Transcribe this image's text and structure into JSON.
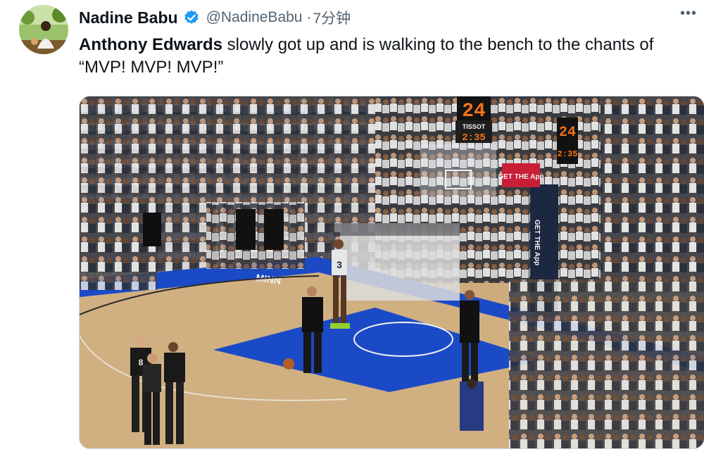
{
  "author": {
    "display_name": "Nadine Babu",
    "handle": "@NadineBabu",
    "separator": "·",
    "time": "7分钟",
    "verified": true
  },
  "tweet": {
    "bold_name": "Anthony Edwards",
    "text_after": " slowly got up and is walking to the bench to the chants of “MVP! MVP! MVP!”"
  },
  "icons": {
    "more": "more-icon",
    "verified": "verified-badge-icon"
  },
  "media": {
    "shot_clock": "24",
    "game_clock": "2:35",
    "sponsor_sign": "TISSOT",
    "ad_board": "GET THE App",
    "side_clock_top": "24",
    "side_clock_bottom": "2:35",
    "jersey_number": "3",
    "ref_jersey": "8",
    "banner_text": "MINN"
  },
  "colors": {
    "name": "#0f1419",
    "secondary": "#536471",
    "verified": "#1d9bf0",
    "court_blue": "#1d4fd1",
    "court_wood": "#d9b584"
  }
}
